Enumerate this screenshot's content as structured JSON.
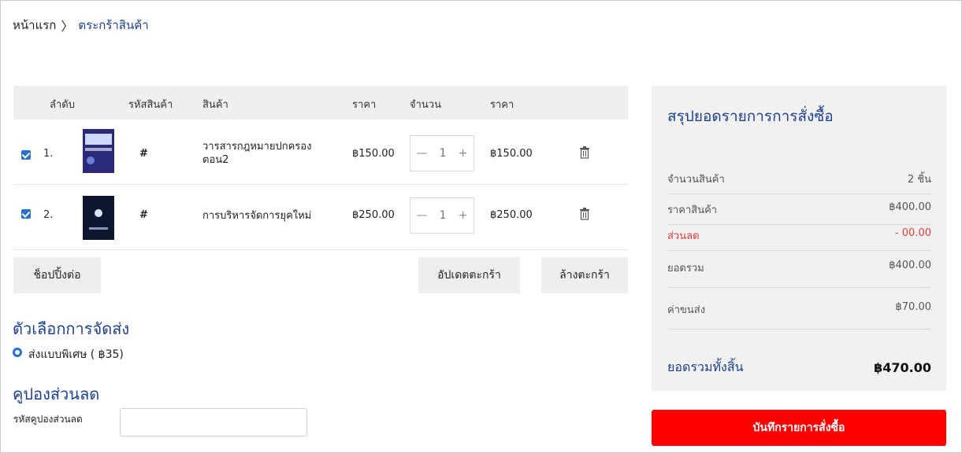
{
  "breadcrumb": {
    "home": "หน้าแรก",
    "current": "ตระกร้าสินค้า",
    "separator": "〉"
  },
  "cart": {
    "headers": {
      "index": "ลำดับ",
      "code": "รหัสสินค้า",
      "product": "สินค้า",
      "price": "ราคา",
      "qty": "จำนวน",
      "total": "ราคา"
    },
    "rows": [
      {
        "checked": true,
        "index": "1.",
        "code": "#",
        "name": "วารสารกฎหมายปกครอง ตอน2",
        "price": "฿150.00",
        "qty": "1",
        "total": "฿150.00",
        "thumb_color": "#2b2a7a"
      },
      {
        "checked": true,
        "index": "2.",
        "code": "#",
        "name": "การบริหารจัดการยุคใหม่",
        "price": "฿250.00",
        "qty": "1",
        "total": "฿250.00",
        "thumb_color": "#0f1630"
      }
    ],
    "qty_minus": "—",
    "qty_plus": "+"
  },
  "buttons": {
    "continue": "ช็อปปิ้งต่อ",
    "update": "อัปเดตตะกร้า",
    "clear": "ล้างตะกร้า",
    "save": "บันทึกรายการสั่งซื้อ"
  },
  "shipping": {
    "title": "ตัวเลือกการจัดส่ง",
    "option": "ส่งแบบพิเศษ ( ฿35)"
  },
  "coupon": {
    "title": "คูปองส่วนลด",
    "label": "รหัสคูปองส่วนลด",
    "placeholder": ""
  },
  "summary": {
    "title": "สรุปยอดรายการการสั่งซื้อ",
    "items_label": "จำนวนสินค้า",
    "items_value": "2 ชิ้น",
    "price_label": "ราคาสินค้า",
    "price_value": "฿400.00",
    "discount_label": "ส่วนลด",
    "discount_value": "- 00.00",
    "subtotal_label": "ยอดรวม",
    "subtotal_value": "฿400.00",
    "shipping_label": "ค่าขนส่ง",
    "shipping_value": "฿70.00",
    "grand_label": "ยอดรวมทั้งสิ้น",
    "grand_value": "฿470.00"
  },
  "colors": {
    "accent": "#1d3f8f",
    "danger": "#ff0000",
    "checkbox": "#2a6fd6"
  }
}
